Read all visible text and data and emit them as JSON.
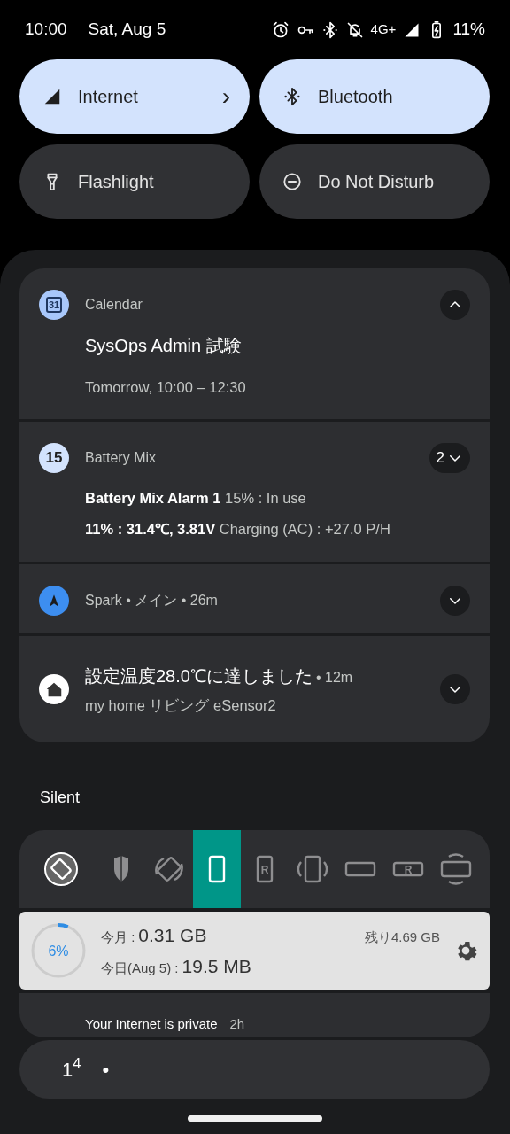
{
  "status_bar": {
    "time": "10:00",
    "date": "Sat, Aug 5",
    "network": "4G+",
    "battery": "11%"
  },
  "tiles": [
    {
      "label": "Internet",
      "kind": "signal",
      "on": true,
      "chevron": "›"
    },
    {
      "label": "Bluetooth",
      "kind": "bluetooth",
      "on": true
    },
    {
      "label": "Flashlight",
      "kind": "flashlight",
      "on": false
    },
    {
      "label": "Do Not Disturb",
      "kind": "dnd",
      "on": false
    }
  ],
  "notifications": [
    {
      "app": "Calendar",
      "kind": "calendar",
      "icon_text": "31",
      "expanded": true,
      "title": "SysOps Admin 試験",
      "lines": [
        "Tomorrow, 10:00 – 12:30"
      ]
    },
    {
      "app": "Battery Mix",
      "kind": "badge",
      "icon_text": "15",
      "expanded": false,
      "count": "2",
      "lines": [
        "**Battery Mix Alarm 1** 15% : In use",
        "**11% : 31.4℃, 3.81V** Charging (AC) : +27.0 P/H"
      ]
    },
    {
      "app": "Spark • メイン • 26m",
      "kind": "spark",
      "expanded": false
    },
    {
      "kind": "home",
      "expanded": false,
      "title": "設定温度28.0℃に達しました",
      "time": "• 12m",
      "lines": [
        "my home リビング eSensor2"
      ]
    }
  ],
  "section_label": "Silent",
  "rotation_modes": [
    {
      "kind": "auto-circle",
      "selected": false
    },
    {
      "kind": "shield",
      "selected": false
    },
    {
      "kind": "auto",
      "selected": false
    },
    {
      "kind": "portrait",
      "selected": true
    },
    {
      "kind": "portrait-r",
      "letter": "R",
      "selected": false
    },
    {
      "kind": "portrait-sensor",
      "selected": false
    },
    {
      "kind": "landscape",
      "selected": false
    },
    {
      "kind": "landscape-r",
      "letter": "R",
      "selected": false
    },
    {
      "kind": "landscape-sensor",
      "selected": false
    }
  ],
  "data_usage": {
    "level": 0.06,
    "percent": "6%",
    "month_label": "今月 :",
    "month_value": "0.31 GB",
    "remaining": "残り4.69 GB",
    "today_label": "今日(Aug 5) :",
    "today_value": "19.5 MB"
  },
  "peek_notification": {
    "title": "Your Internet is private",
    "time": "2h"
  },
  "bottom_bar": {
    "text": "1$^{4}$",
    "dot": "•"
  }
}
